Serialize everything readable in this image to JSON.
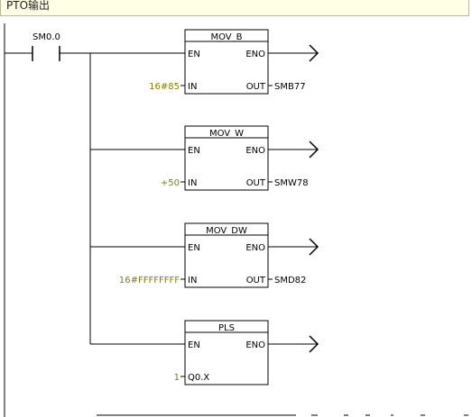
{
  "network_comment": "PTO输出",
  "contact": {
    "label": "SM0.0"
  },
  "blocks": [
    {
      "title": "MOV_B",
      "en": "EN",
      "eno": "ENO",
      "in_label": "IN",
      "out_label": "OUT",
      "in_value": "16#85",
      "out_value": "SMB77"
    },
    {
      "title": "MOV_W",
      "en": "EN",
      "eno": "ENO",
      "in_label": "IN",
      "out_label": "OUT",
      "in_value": "+50",
      "out_value": "SMW78"
    },
    {
      "title": "MOV_DW",
      "en": "EN",
      "eno": "ENO",
      "in_label": "IN",
      "out_label": "OUT",
      "in_value": "16#FFFFFFFF",
      "out_value": "SMD82"
    },
    {
      "title": "PLS",
      "en": "EN",
      "eno": "ENO",
      "in_label": "Q0.X",
      "in_value": "1"
    }
  ],
  "colors": {
    "operand": "#808000",
    "wire": "#000000",
    "comment_bg": "#ffffe6"
  }
}
